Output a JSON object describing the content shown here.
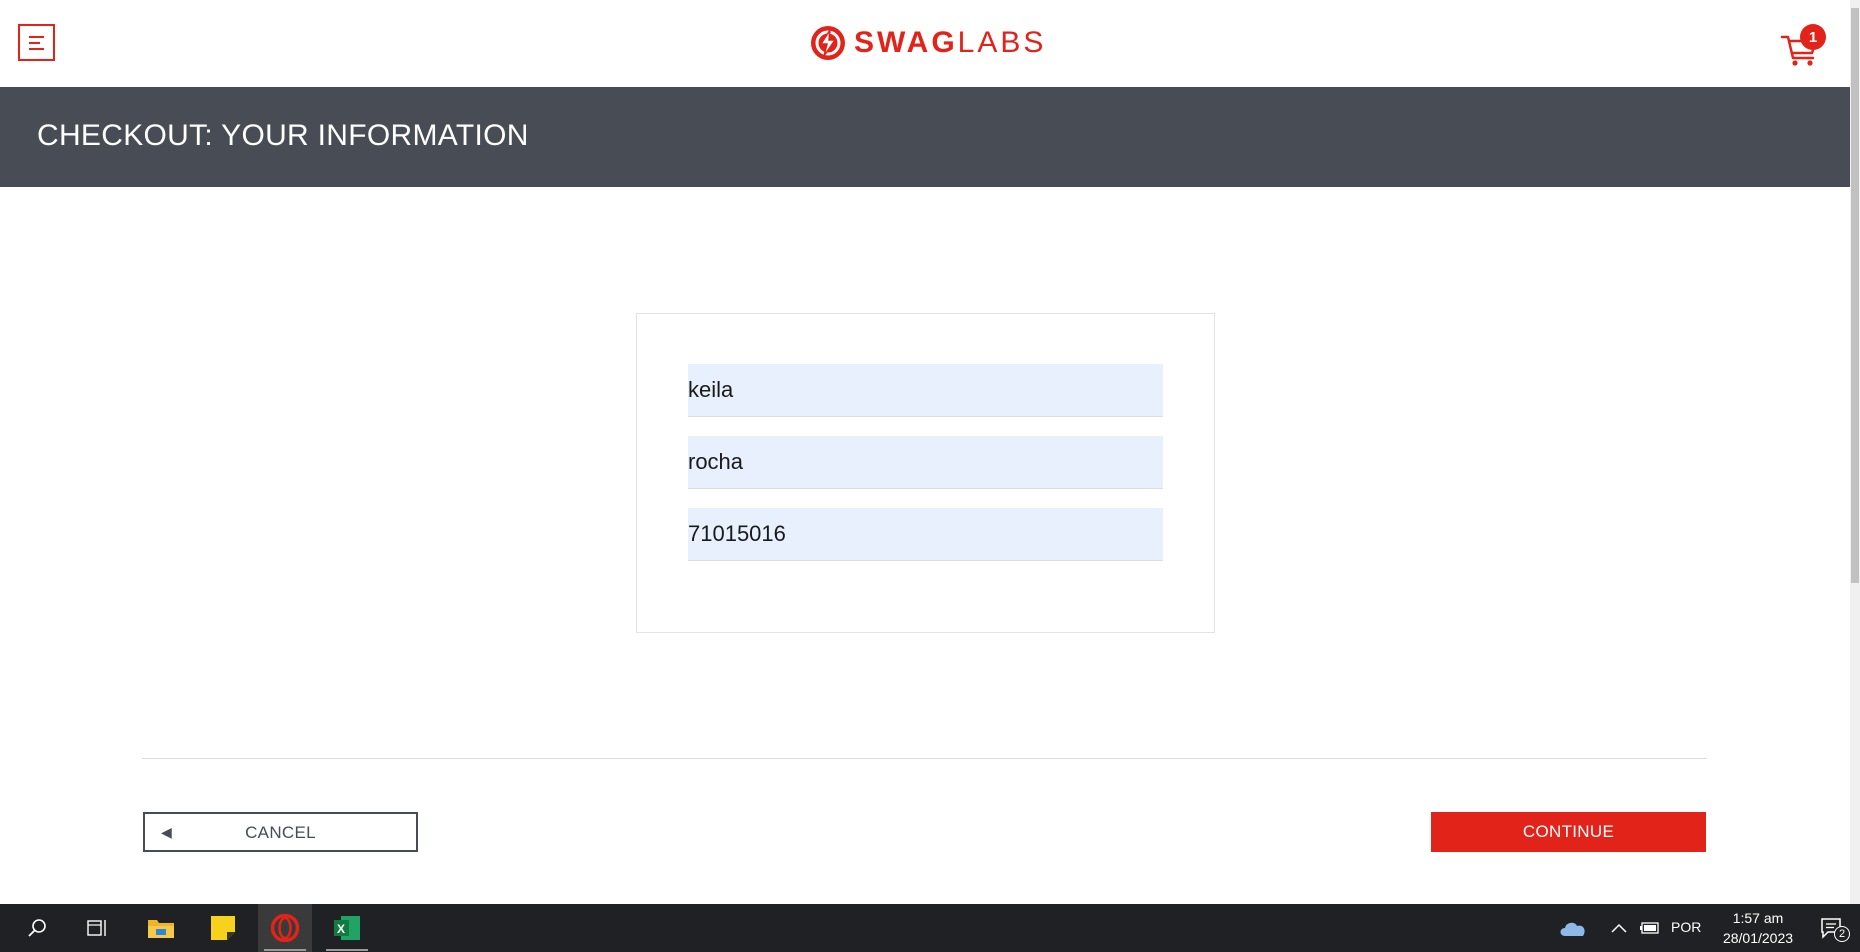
{
  "header": {
    "logo_text_bold": "SWAG",
    "logo_text_light": "LABS",
    "cart_count": "1",
    "colors": {
      "brand": "#e2231a",
      "subheader_bg": "#474c55"
    }
  },
  "subheader": {
    "title": "CHECKOUT: YOUR INFORMATION"
  },
  "form": {
    "first_name": "keila",
    "last_name": "rocha",
    "postal_code": "71015016"
  },
  "buttons": {
    "cancel_label": "CANCEL",
    "continue_label": "CONTINUE"
  },
  "taskbar": {
    "language": "POR",
    "time": "1:57 am",
    "date": "28/01/2023",
    "notification_count": "2",
    "icons": [
      "search-icon",
      "task-view-icon",
      "file-explorer-icon",
      "sticky-notes-icon",
      "opera-icon",
      "excel-icon"
    ]
  }
}
